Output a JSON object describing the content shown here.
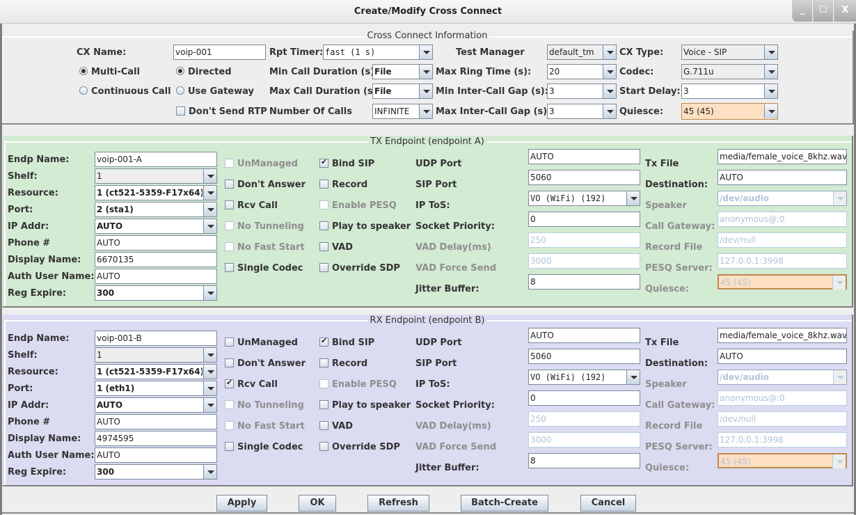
{
  "window": {
    "title": "Create/Modify Cross Connect",
    "controls": {
      "minimize": "_",
      "maximize": "☐",
      "close": "X"
    }
  },
  "cx_info": {
    "group_title": "Cross Connect Information",
    "cx_name_label": "CX Name:",
    "cx_name_value": "voip-001",
    "multi_call_label": "Multi-Call",
    "multi_call_selected": true,
    "continuous_call_label": "Continuous Call",
    "continuous_call_selected": false,
    "directed_label": "Directed",
    "directed_selected": true,
    "use_gateway_label": "Use Gateway",
    "use_gateway_selected": false,
    "dont_send_rtp_label": "Don't Send RTP",
    "dont_send_rtp_checked": false,
    "rpt_timer_label": "Rpt Timer:",
    "rpt_timer_value": "fast      (1 s)",
    "min_call_duration_label": "Min Call Duration (s)",
    "min_call_duration_value": "File",
    "max_call_duration_label": "Max Call Duration (s)",
    "max_call_duration_value": "File",
    "number_of_calls_label": "Number Of Calls",
    "number_of_calls_value": "INFINITE",
    "test_manager_label": "Test Manager",
    "test_manager_value": "default_tm",
    "max_ring_time_label": "Max Ring Time (s):",
    "max_ring_time_value": "20",
    "min_inter_call_gap_label": "Min Inter-Call Gap (s):",
    "min_inter_call_gap_value": "3",
    "max_inter_call_gap_label": "Max Inter-Call Gap (s):",
    "max_inter_call_gap_value": "3",
    "cx_type_label": "CX Type:",
    "cx_type_value": "Voice - SIP",
    "codec_label": "Codec:",
    "codec_value": "G.711u",
    "start_delay_label": "Start Delay:",
    "start_delay_value": "3",
    "quiesce_label": "Quiesce:",
    "quiesce_value": "45 (45)"
  },
  "labels": {
    "endp_name": "Endp Name:",
    "shelf": "Shelf:",
    "resource": "Resource:",
    "port": "Port:",
    "ip_addr": "IP Addr:",
    "phone": "Phone #",
    "display_name": "Display Name:",
    "auth_user_name": "Auth User Name:",
    "reg_expire": "Reg Expire:",
    "unmanaged": "UnManaged",
    "dont_answer": "Don't Answer",
    "rcv_call": "Rcv Call",
    "no_tunneling": "No Tunneling",
    "no_fast_start": "No Fast Start",
    "single_codec": "Single Codec",
    "bind_sip": "Bind SIP",
    "record": "Record",
    "enable_pesq": "Enable PESQ",
    "play_to_speaker": "Play to speaker",
    "vad": "VAD",
    "override_sdp": "Override SDP",
    "udp_port": "UDP Port",
    "sip_port": "SIP Port",
    "ip_tos": "IP ToS:",
    "socket_priority": "Socket Priority:",
    "vad_delay": "VAD Delay(ms)",
    "vad_force_send": "VAD Force Send",
    "jitter_buffer": "Jitter Buffer:",
    "tx_file": "Tx File",
    "destination": "Destination:",
    "speaker": "Speaker",
    "call_gateway": "Call Gateway:",
    "record_file": "Record File",
    "pesq_server": "PESQ Server:",
    "quiesce": "Quiesce:"
  },
  "tx": {
    "group_title": "TX Endpoint (endpoint A)",
    "endp_name": "voip-001-A",
    "shelf": "1",
    "resource": "1 (ct521-5359-F17x64)",
    "port": "2 (sta1)",
    "ip_addr": "AUTO",
    "phone": "AUTO",
    "display_name": "6670135",
    "auth_user_name": "AUTO",
    "reg_expire": "300",
    "unmanaged": false,
    "unmanaged_enabled": false,
    "dont_answer": false,
    "rcv_call": false,
    "no_tunneling": false,
    "no_fast_start": false,
    "single_codec": false,
    "bind_sip": true,
    "record": false,
    "enable_pesq": false,
    "play_to_speaker": false,
    "vad": false,
    "override_sdp": false,
    "udp_port": "AUTO",
    "sip_port": "5060",
    "ip_tos": "VO (WiFi)     (192)",
    "socket_priority": "0",
    "vad_delay": "250",
    "vad_force_send": "3000",
    "jitter_buffer": "8",
    "tx_file": "media/female_voice_8khz.wav",
    "destination": "AUTO",
    "speaker": "/dev/audio",
    "call_gateway": "anonymous@:0",
    "record_file": "/dev/null",
    "pesq_server": "127.0.0.1:3998",
    "quiesce": "45 (45)"
  },
  "rx": {
    "group_title": "RX Endpoint (endpoint B)",
    "endp_name": "voip-001-B",
    "shelf": "1",
    "resource": "1 (ct521-5359-F17x64)",
    "port": "1 (eth1)",
    "ip_addr": "AUTO",
    "phone": "AUTO",
    "display_name": "4974595",
    "auth_user_name": "AUTO",
    "reg_expire": "300",
    "unmanaged": false,
    "unmanaged_enabled": true,
    "dont_answer": false,
    "rcv_call": true,
    "no_tunneling": false,
    "no_fast_start": false,
    "single_codec": false,
    "bind_sip": true,
    "record": false,
    "enable_pesq": false,
    "play_to_speaker": false,
    "vad": false,
    "override_sdp": false,
    "udp_port": "AUTO",
    "sip_port": "5060",
    "ip_tos": "VO (WiFi)     (192)",
    "socket_priority": "0",
    "vad_delay": "250",
    "vad_force_send": "3000",
    "jitter_buffer": "8",
    "tx_file": "media/female_voice_8khz.wav",
    "destination": "AUTO",
    "speaker": "/dev/audio",
    "call_gateway": "anonymous@:0",
    "record_file": "/dev/null",
    "pesq_server": "127.0.0.1:3998",
    "quiesce": "45 (45)"
  },
  "buttons": {
    "apply": "Apply",
    "ok": "OK",
    "refresh": "Refresh",
    "batch_create": "Batch-Create",
    "cancel": "Cancel"
  },
  "colors": {
    "tx_background": "#d3ead3",
    "rx_background": "#dbdbf2",
    "quiesce_highlight": "#fde0c2"
  }
}
